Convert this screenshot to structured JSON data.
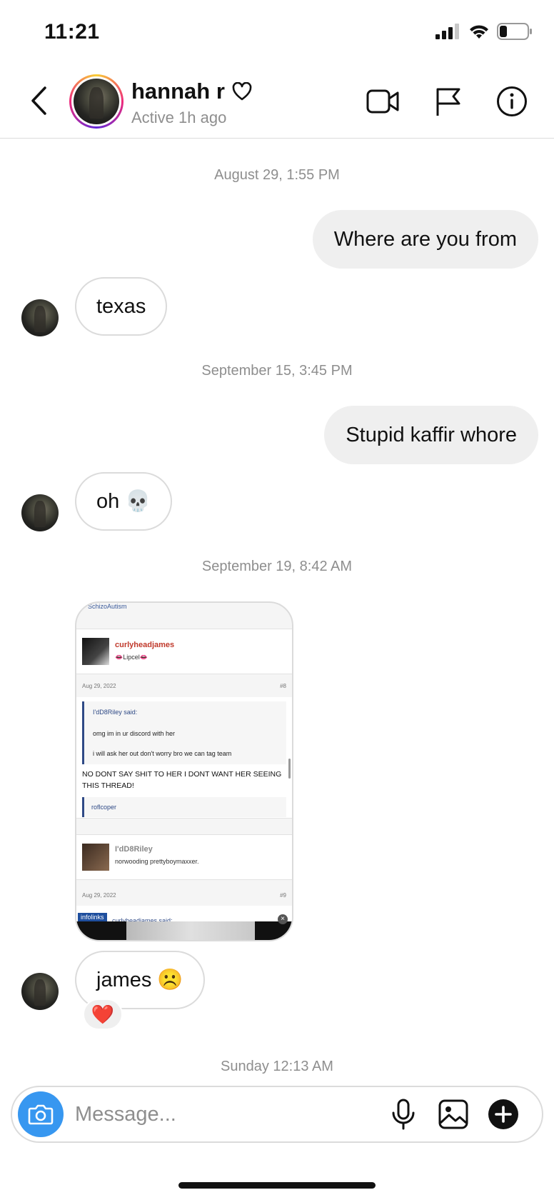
{
  "status_bar": {
    "time": "11:21"
  },
  "header": {
    "name": "hannah r",
    "status": "Active 1h ago"
  },
  "conversation": {
    "timestamps": [
      "August 29, 1:55 PM",
      "September 15, 3:45 PM",
      "September 19, 8:42 AM",
      "Sunday 12:13 AM"
    ],
    "messages": [
      {
        "from": "me",
        "text": "Where are you from"
      },
      {
        "from": "them",
        "text": "texas"
      },
      {
        "from": "me",
        "text": "Stupid kaffir whore"
      },
      {
        "from": "them",
        "text": "oh 💀"
      },
      {
        "from": "them",
        "type": "image"
      },
      {
        "from": "them",
        "text": "james ☹️",
        "reaction": "❤️"
      }
    ]
  },
  "shared_image": {
    "top_strip": "SchizoAutism",
    "post1": {
      "username": "curlyheadjames",
      "tag": "👄Lipcel👄",
      "date": "Aug 29, 2022",
      "number": "#8",
      "quote_author": "I'dD8Riley said:",
      "quote_lines": [
        "omg im in ur discord with her",
        "i will ask her out don't worry bro we can tag team"
      ],
      "body": "NO DONT SAY SHIT TO HER I DONT WANT HER SEEING THIS THREAD!",
      "reaction_user": "roflcoper"
    },
    "post2": {
      "username": "I'dD8Riley",
      "tag": "norwooding prettyboymaxxer.",
      "date": "Aug 29, 2022",
      "number": "#9",
      "quote_author": "curlyheadjames said:"
    },
    "ad_label": "infolinks"
  },
  "composer": {
    "placeholder": "Message..."
  },
  "colors": {
    "accent": "#3797f0",
    "bubble_out": "#efefef",
    "border": "#dbdbdb",
    "muted_text": "#8e8e8e"
  }
}
